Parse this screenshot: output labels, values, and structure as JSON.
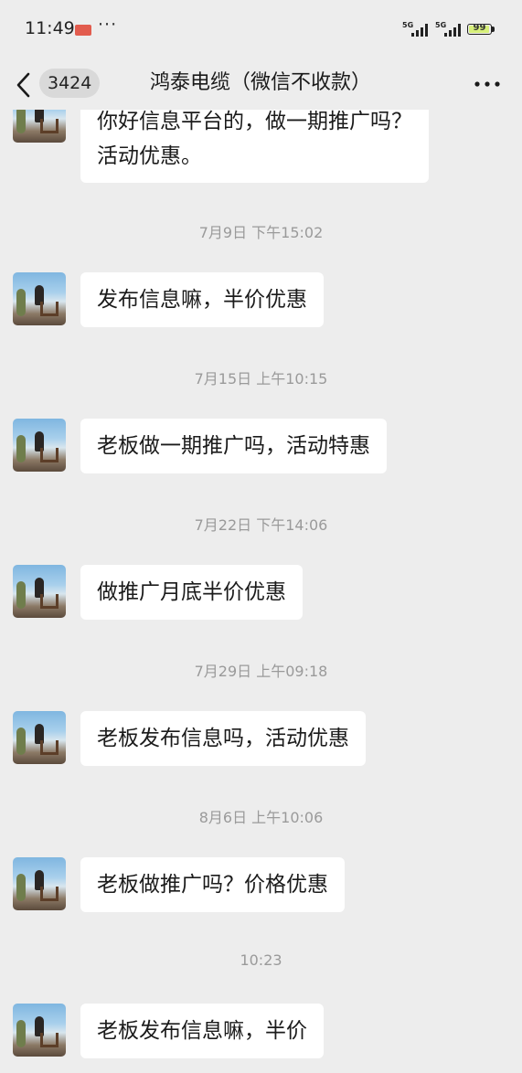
{
  "status_bar": {
    "time": "11:49",
    "more": "···",
    "network1": "5G",
    "network2": "5G",
    "battery_level": "99",
    "battery_percent": 99
  },
  "nav": {
    "back_icon": "chevron-left-icon",
    "unread_count": "3424",
    "title": "鸿泰电缆（微信不收款）",
    "more_icon": "ellipsis-horizontal-icon"
  },
  "timestamps": [
    "7月9日 下午15:02",
    "7月15日 上午10:15",
    "7月22日 下午14:06",
    "7月29日 上午09:18",
    "8月6日 上午10:06",
    "10:23"
  ],
  "messages": [
    {
      "lines": [
        "你好信息平台的，做一期推广吗？",
        "活动优惠。"
      ]
    },
    {
      "text": "发布信息嘛，半价优惠"
    },
    {
      "text": "老板做一期推广吗，活动特惠"
    },
    {
      "text": "做推广月底半价优惠"
    },
    {
      "text": "老板发布信息吗，活动优惠"
    },
    {
      "text": "老板做推广吗？价格优惠"
    },
    {
      "text": "老板发布信息嘛，半价"
    }
  ],
  "colors": {
    "background": "#ededed",
    "bubble": "#ffffff",
    "timestamp": "#9a9a9a"
  }
}
